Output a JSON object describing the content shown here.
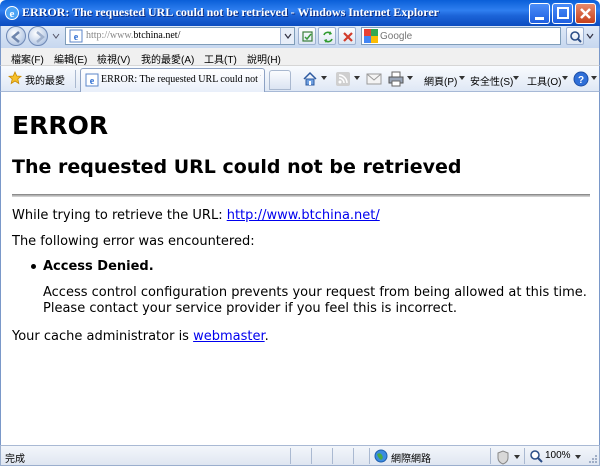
{
  "window": {
    "title": "ERROR: The requested URL could not be retrieved - Windows Internet Explorer"
  },
  "address_bar": {
    "url_prefix": "http://www.",
    "url_domain": "btchina.net/"
  },
  "search": {
    "placeholder": "Google",
    "engine_icon": "google-icon"
  },
  "menu": [
    {
      "label": "檔案(F)"
    },
    {
      "label": "編輯(E)"
    },
    {
      "label": "檢視(V)"
    },
    {
      "label": "我的最愛(A)"
    },
    {
      "label": "工具(T)"
    },
    {
      "label": "說明(H)"
    }
  ],
  "favorites": {
    "label": "我的最愛"
  },
  "tab": {
    "label": "ERROR: The requested URL could not be ..."
  },
  "command_bar": {
    "page_label": "網頁(P)",
    "safety_label": "安全性(S)",
    "tools_label": "工具(O)"
  },
  "page": {
    "heading": "ERROR",
    "subheading": "The requested URL could not be retrieved",
    "retrieve_text": "While trying to retrieve the URL: ",
    "retrieve_url": "http://www.btchina.net/",
    "encountered_text": "The following error was encountered:",
    "error_title": "Access Denied.",
    "error_desc_line1": "Access control configuration prevents your request from being allowed at this time.",
    "error_desc_line2": "Please contact your service provider if you feel this is incorrect.",
    "admin_text": "Your cache administrator is ",
    "admin_link": "webmaster",
    "admin_end": "."
  },
  "status_bar": {
    "status": "完成",
    "zone": "網際網路",
    "zoom": "100%"
  },
  "colors": {
    "titlebar": "#1c64d8",
    "link": "#0000ee"
  }
}
